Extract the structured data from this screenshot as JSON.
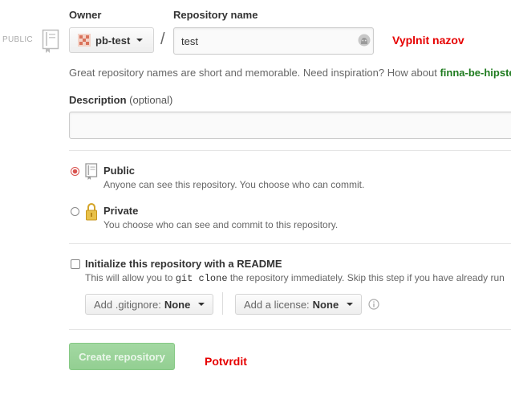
{
  "visibility_tag": "PUBLIC",
  "owner": {
    "label": "Owner",
    "selected": "pb-test"
  },
  "repo": {
    "label": "Repository name",
    "separator": "/",
    "value": "test"
  },
  "annotations": {
    "name_hint": "Vyplnit nazov",
    "confirm_hint": "Potvrdit"
  },
  "name_help": {
    "text": "Great repository names are short and memorable. Need inspiration? How about ",
    "suggestion": "finna-be-hipster"
  },
  "description": {
    "label": "Description",
    "optional": "(optional)",
    "value": ""
  },
  "visibility": {
    "public": {
      "title": "Public",
      "note": "Anyone can see this repository. You choose who can commit.",
      "selected": true
    },
    "private": {
      "title": "Private",
      "note": "You choose who can see and commit to this repository.",
      "selected": false
    }
  },
  "readme": {
    "label": "Initialize this repository with a README",
    "note_before": "This will allow you to ",
    "note_code": "git clone",
    "note_after": " the repository immediately. Skip this step if you have already run",
    "checked": false
  },
  "gitignore": {
    "label": "Add .gitignore:",
    "value": "None"
  },
  "license": {
    "label": "Add a license:",
    "value": "None"
  },
  "create_button": "Create repository",
  "colors": {
    "accent_green": "#1e7b1e",
    "annotation_red": "#e60000",
    "button_green": "#9ad49a",
    "radio_selected": "#d9534f"
  },
  "icons": {
    "repo": "repo-book-icon",
    "avatar": "owner-avatar-icon",
    "input": "octoface-icon",
    "public": "repo-book-icon",
    "private": "lock-icon",
    "info": "info-circle-icon"
  }
}
